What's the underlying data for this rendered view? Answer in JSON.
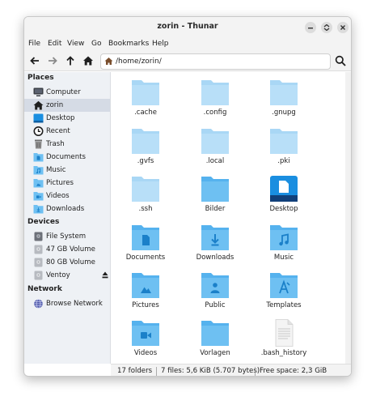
{
  "window": {
    "title": "zorin - Thunar"
  },
  "menu": [
    "File",
    "Edit",
    "View",
    "Go",
    "Bookmarks",
    "Help"
  ],
  "toolbar": {
    "path": "/home/zorin/"
  },
  "sidebar": {
    "places_label": "Places",
    "places": [
      {
        "label": "Computer",
        "icon": "computer-icon"
      },
      {
        "label": "zorin",
        "icon": "home-icon",
        "selected": true
      },
      {
        "label": "Desktop",
        "icon": "desktop-icon"
      },
      {
        "label": "Recent",
        "icon": "recent-icon"
      },
      {
        "label": "Trash",
        "icon": "trash-icon"
      },
      {
        "label": "Documents",
        "icon": "folder-icon"
      },
      {
        "label": "Music",
        "icon": "folder-icon"
      },
      {
        "label": "Pictures",
        "icon": "folder-icon"
      },
      {
        "label": "Videos",
        "icon": "folder-icon"
      },
      {
        "label": "Downloads",
        "icon": "folder-icon"
      }
    ],
    "devices_label": "Devices",
    "devices": [
      {
        "label": "File System",
        "icon": "drive-icon"
      },
      {
        "label": "47 GB Volume",
        "icon": "drive-icon"
      },
      {
        "label": "80 GB Volume",
        "icon": "drive-icon"
      },
      {
        "label": "Ventoy",
        "icon": "drive-icon",
        "ejectable": true
      }
    ],
    "network_label": "Network",
    "network": [
      {
        "label": "Browse Network",
        "icon": "network-icon"
      }
    ]
  },
  "files": [
    {
      "name": ".cache",
      "type": "hidden-folder"
    },
    {
      "name": ".config",
      "type": "hidden-folder"
    },
    {
      "name": ".gnupg",
      "type": "hidden-folder"
    },
    {
      "name": ".gvfs",
      "type": "hidden-folder"
    },
    {
      "name": ".local",
      "type": "hidden-folder"
    },
    {
      "name": ".pki",
      "type": "hidden-folder"
    },
    {
      "name": ".ssh",
      "type": "hidden-folder"
    },
    {
      "name": "Bilder",
      "type": "folder"
    },
    {
      "name": "Desktop",
      "type": "desktop-folder"
    },
    {
      "name": "Documents",
      "type": "documents-folder"
    },
    {
      "name": "Downloads",
      "type": "downloads-folder"
    },
    {
      "name": "Music",
      "type": "music-folder"
    },
    {
      "name": "Pictures",
      "type": "pictures-folder"
    },
    {
      "name": "Public",
      "type": "public-folder"
    },
    {
      "name": "Templates",
      "type": "templates-folder"
    },
    {
      "name": "Videos",
      "type": "videos-folder"
    },
    {
      "name": "Vorlagen",
      "type": "folder"
    },
    {
      "name": ".bash_history",
      "type": "text-file"
    }
  ],
  "status": {
    "folders": "17 folders",
    "files": "7 files: 5,6 KiB (5.707 bytes)",
    "free": "Free space: 2,3 GiB"
  },
  "colors": {
    "folder": "#6ec0f2",
    "folder_hidden": "#b8dff8",
    "folder_glyph": "#1b80c9",
    "accent": "#1578c8"
  }
}
